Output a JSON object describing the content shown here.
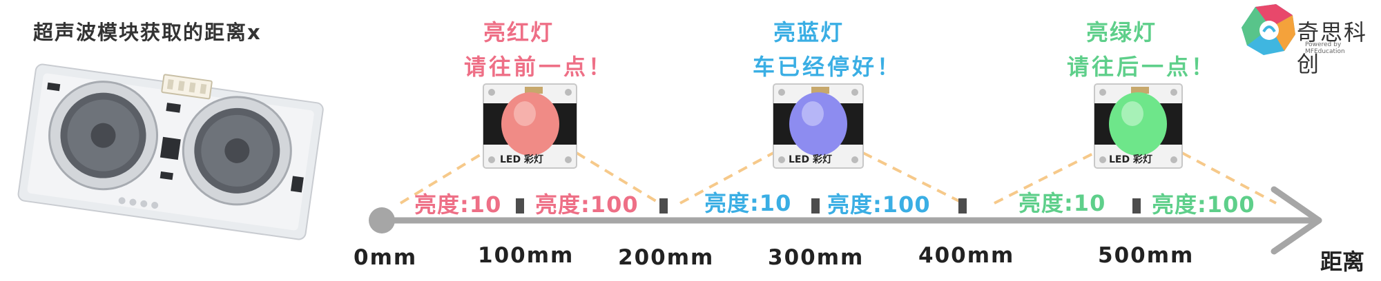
{
  "title": "超声波模块获取的距离x",
  "axis": {
    "name": "距离",
    "ticks": [
      "0mm",
      "100mm",
      "200mm",
      "300mm",
      "400mm",
      "500mm"
    ]
  },
  "zones": [
    {
      "led_title": "亮红灯",
      "message": "请往前一点！",
      "led_color": "#f07a7a",
      "text_color": "#ee6f86",
      "brightness_low": "亮度:10",
      "brightness_high": "亮度:100",
      "module_label": "LED 彩灯"
    },
    {
      "led_title": "亮蓝灯",
      "message": "车已经停好！",
      "led_color": "#8d8cf0",
      "text_color": "#3aaee4",
      "brightness_low": "亮度:10",
      "brightness_high": "亮度:100",
      "module_label": "LED 彩灯"
    },
    {
      "led_title": "亮绿灯",
      "message": "请往后一点！",
      "led_color": "#6ee68a",
      "text_color": "#5ecf8a",
      "brightness_low": "亮度:10",
      "brightness_high": "亮度:100",
      "module_label": "LED 彩灯"
    }
  ],
  "brand": {
    "name": "奇思科创",
    "tagline": "Powered by MFEducation"
  },
  "colors": {
    "axis": "#a6a6a6",
    "tick_mark": "#4d4d4d",
    "dashed": "#f6c98a",
    "logo": [
      "#e8486b",
      "#f4a23b",
      "#3fb6e0",
      "#58c48a"
    ]
  }
}
